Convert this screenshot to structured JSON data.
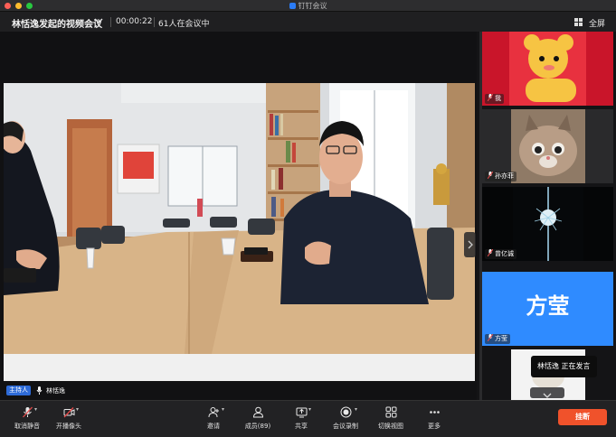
{
  "window": {
    "title": "钉钉会议"
  },
  "header": {
    "meeting_title": "林恬逸发起的视频会议",
    "elapsed": "00:00:22",
    "participants": "61人在会议中",
    "fullscreen_label": "全屏"
  },
  "stage": {
    "host_badge": "主持人",
    "host_name": "林恬逸"
  },
  "sidebar": {
    "tiles": [
      {
        "name": "我",
        "kind": "avatar-cartoon"
      },
      {
        "name": "孙亦菲",
        "kind": "avatar-cat"
      },
      {
        "name": "曾亿诚",
        "kind": "avatar-tower"
      },
      {
        "name": "方莹",
        "kind": "name-card",
        "card_text": "方莹",
        "card_color": "#2f8bff"
      },
      {
        "name": "",
        "kind": "avatar-partial"
      }
    ],
    "speaking_popup": "林恬逸  正在发言"
  },
  "toolbar": {
    "unmute_label": "取消静音",
    "camera_label": "开播像头",
    "invite_label": "邀请",
    "members_label": "成员(89)",
    "share_label": "共享",
    "record_label": "会议录制",
    "switch_view_label": "切换视图",
    "more_label": "更多",
    "hangup_label": "挂断"
  },
  "colors": {
    "accent": "#2e6bd8",
    "hangup": "#f0522b",
    "muted": "#e54b4b"
  }
}
